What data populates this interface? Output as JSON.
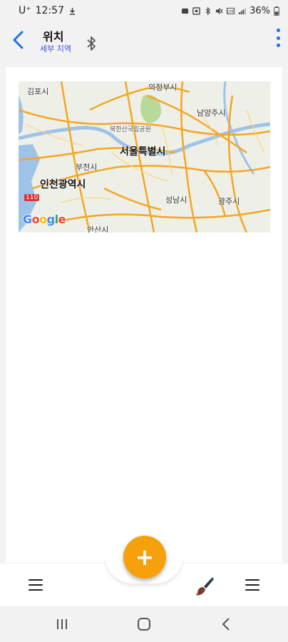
{
  "status": {
    "carrier": "U⁺",
    "time": "12:57",
    "battery": "36%"
  },
  "header": {
    "title": "위치",
    "subtitle": "세부 지역"
  },
  "map": {
    "labels": {
      "gimpo": "김포시",
      "uijeongbu": "의정부시",
      "namyangju": "남양주시",
      "bukhansan": "북한산국립공원",
      "seoul": "서울특별시",
      "bucheon": "부천시",
      "incheon": "인천광역시",
      "seongnam": "성남시",
      "gwangju": "광주시",
      "ansan": "안산시",
      "expressway": "110"
    },
    "google": [
      "G",
      "o",
      "o",
      "g",
      "l",
      "e"
    ],
    "google_colors": [
      "#4285F4",
      "#EA4335",
      "#FBBC05",
      "#4285F4",
      "#34A853",
      "#EA4335"
    ]
  },
  "fab": {
    "label": "+"
  },
  "colors": {
    "accent": "#f6a00c",
    "link": "#1a73e8",
    "subtitle": "#3b4fd8"
  }
}
